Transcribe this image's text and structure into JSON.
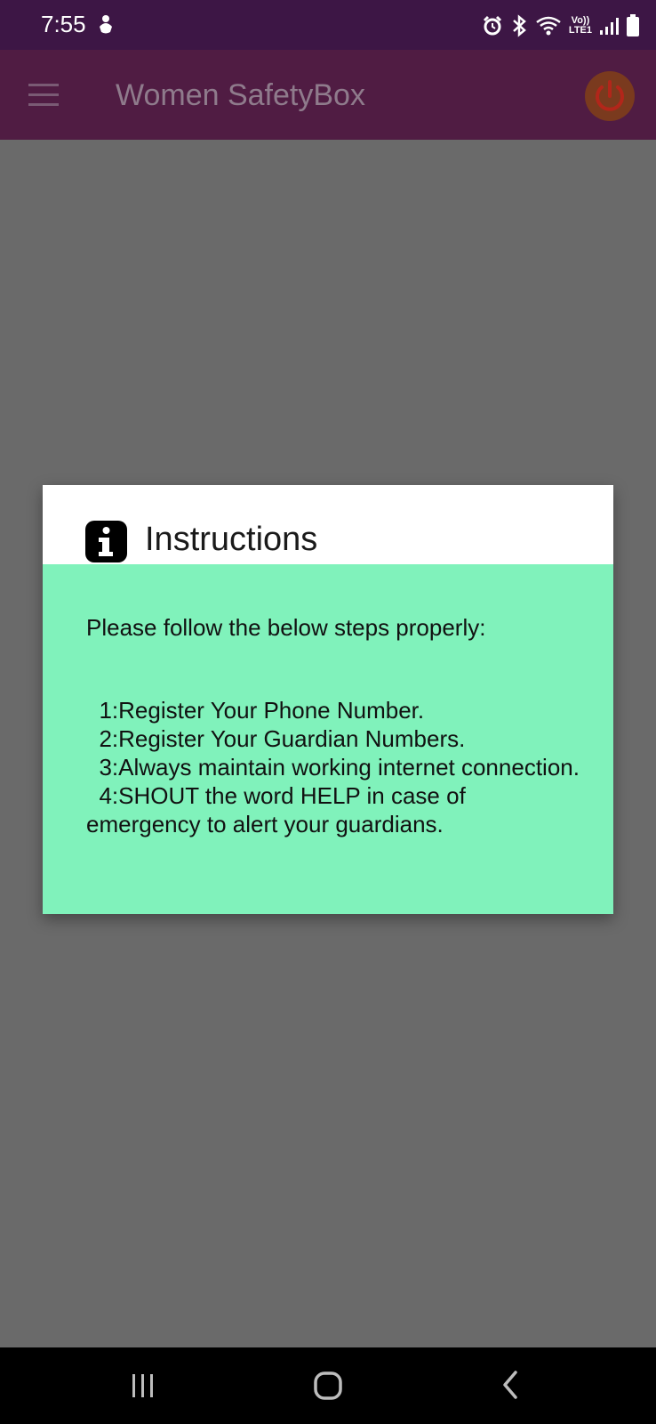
{
  "status_bar": {
    "time": "7:55",
    "network_label_top": "Vo))",
    "network_label_bottom": "LTE1",
    "icons": [
      "notification-icon",
      "alarm-icon",
      "bluetooth-icon",
      "wifi-icon",
      "signal-icon",
      "battery-icon"
    ]
  },
  "app_bar": {
    "title": "Women SafetyBox",
    "menu_icon": "menu-icon",
    "power_icon": "power-icon",
    "power_color": "#b2261a"
  },
  "dialog": {
    "title": "Instructions",
    "icon": "info-icon",
    "intro": "Please follow the below steps properly:",
    "steps": [
      "  1:Register Your Phone Number.",
      "  2:Register Your Guardian Numbers.",
      "  3:Always maintain working internet connection.",
      "  4:SHOUT the word HELP in case of emergency to alert your guardians."
    ],
    "body_color": "#80f2bb"
  },
  "nav_bar": {
    "icons": [
      "recents-icon",
      "home-icon",
      "back-icon"
    ]
  }
}
